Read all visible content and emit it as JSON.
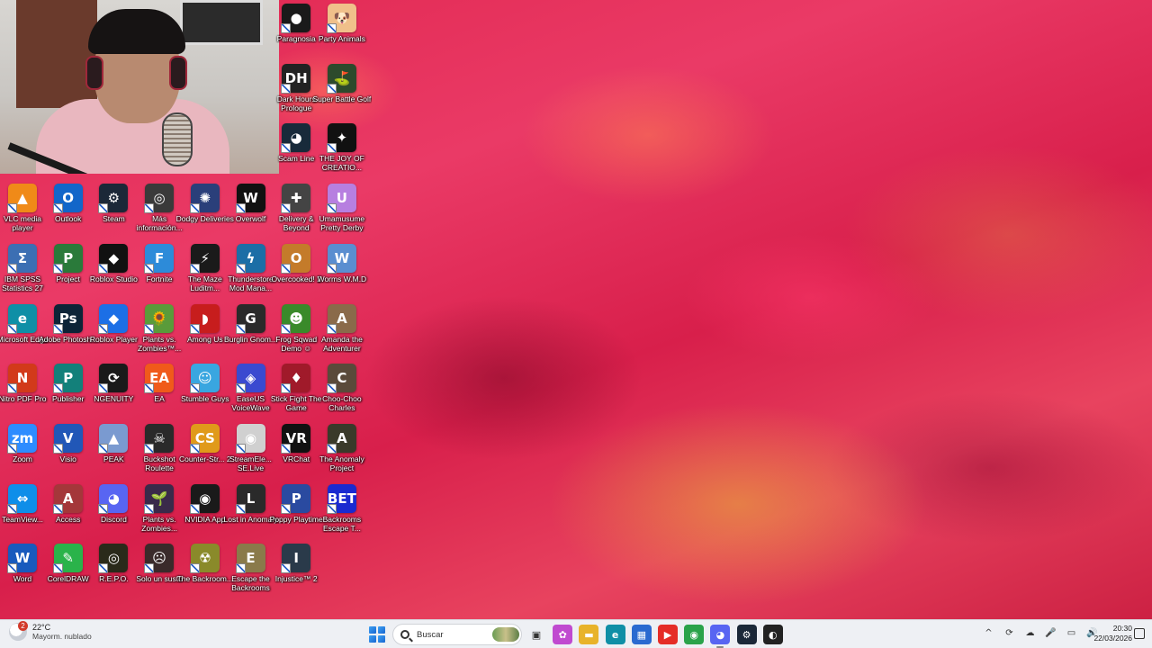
{
  "desktop": {
    "icons": [
      {
        "label": "Paragnosia",
        "glyph": "●",
        "color": "#1a1a1a"
      },
      {
        "label": "Party Animals",
        "glyph": "🐶",
        "color": "#f0c08a"
      },
      {
        "label": "Dark Hours Prologue",
        "glyph": "DH",
        "color": "#222222"
      },
      {
        "label": "Super Battle Golf",
        "glyph": "⛳",
        "color": "#2d4a2c"
      },
      {
        "label": "Scam Line",
        "glyph": "◕",
        "color": "#182a3a"
      },
      {
        "label": "THE JOY OF CREATIO...",
        "glyph": "✦",
        "color": "#111111"
      },
      {
        "label": "VLC media player",
        "glyph": "▲",
        "color": "#f08a18"
      },
      {
        "label": "Outlook",
        "glyph": "O",
        "color": "#1266c9"
      },
      {
        "label": "Steam",
        "glyph": "⚙",
        "color": "#1b2838"
      },
      {
        "label": "Más información...",
        "glyph": "◎",
        "color": "#3a3a3a"
      },
      {
        "label": "Dodgy Deliveries",
        "glyph": "✺",
        "color": "#2a3f7a"
      },
      {
        "label": "Overwolf",
        "glyph": "W",
        "color": "#111111"
      },
      {
        "label": "Delivery & Beyond",
        "glyph": "✚",
        "color": "#444444"
      },
      {
        "label": "Umamusume Pretty Derby",
        "glyph": "U",
        "color": "#b77fe0"
      },
      {
        "label": "IBM SPSS Statistics 27",
        "glyph": "Σ",
        "color": "#3c6fb3"
      },
      {
        "label": "Project",
        "glyph": "P",
        "color": "#2a7a3a"
      },
      {
        "label": "Roblox Studio",
        "glyph": "◆",
        "color": "#111111"
      },
      {
        "label": "Fortnite",
        "glyph": "F",
        "color": "#2d8bd9"
      },
      {
        "label": "The Maze Luditm...",
        "glyph": "⚡",
        "color": "#1a1a1a"
      },
      {
        "label": "Thunderstore Mod Mana...",
        "glyph": "ϟ",
        "color": "#1c6ea6"
      },
      {
        "label": "Overcooked! 2",
        "glyph": "O",
        "color": "#c47b2a"
      },
      {
        "label": "Worms W.M.D",
        "glyph": "W",
        "color": "#5a8ed0"
      },
      {
        "label": "Microsoft Edge",
        "glyph": "e",
        "color": "#0f8fa6"
      },
      {
        "label": "Adobe Photosh...",
        "glyph": "Ps",
        "color": "#0d2437"
      },
      {
        "label": "Roblox Player",
        "glyph": "◆",
        "color": "#1c6fe6"
      },
      {
        "label": "Plants vs. Zombies™...",
        "glyph": "🌻",
        "color": "#5a9b3a"
      },
      {
        "label": "Among Us",
        "glyph": "◗",
        "color": "#c71d1d"
      },
      {
        "label": "Burglin Gnom...",
        "glyph": "G",
        "color": "#2a2a2a"
      },
      {
        "label": "Frog Sqwad Demo ☺",
        "glyph": "☻",
        "color": "#3a8a2a"
      },
      {
        "label": "Amanda the Adventurer",
        "glyph": "A",
        "color": "#8a6a4a"
      },
      {
        "label": "Nitro PDF Pro",
        "glyph": "N",
        "color": "#d23a1a"
      },
      {
        "label": "Publisher",
        "glyph": "P",
        "color": "#13807a"
      },
      {
        "label": "NGENUITY",
        "glyph": "⟳",
        "color": "#1a1a1a"
      },
      {
        "label": "EA",
        "glyph": "EA",
        "color": "#f05a1a"
      },
      {
        "label": "Stumble Guys",
        "glyph": "☺",
        "color": "#39a6e0"
      },
      {
        "label": "EaseUS VoiceWave",
        "glyph": "◈",
        "color": "#3a4ad0"
      },
      {
        "label": "Stick Fight The Game",
        "glyph": "♦",
        "color": "#a01a2a"
      },
      {
        "label": "Choo-Choo Charles",
        "glyph": "C",
        "color": "#5a4a3a"
      },
      {
        "label": "Zoom",
        "glyph": "zm",
        "color": "#2d8cff"
      },
      {
        "label": "Visio",
        "glyph": "V",
        "color": "#2157b7"
      },
      {
        "label": "PEAK",
        "glyph": "▲",
        "color": "#7a9ad0"
      },
      {
        "label": "Buckshot Roulette",
        "glyph": "☠",
        "color": "#2a2a2a"
      },
      {
        "label": "Counter-Str... 2",
        "glyph": "CS",
        "color": "#e09a1a"
      },
      {
        "label": "StreamEle... SE.Live",
        "glyph": "◉",
        "color": "#d0d0d0"
      },
      {
        "label": "VRChat",
        "glyph": "VR",
        "color": "#111111"
      },
      {
        "label": "The Anomaly Project",
        "glyph": "A",
        "color": "#3a3a2a"
      },
      {
        "label": "TeamView...",
        "glyph": "⇔",
        "color": "#0e8ee9"
      },
      {
        "label": "Access",
        "glyph": "A",
        "color": "#a4373a"
      },
      {
        "label": "Discord",
        "glyph": "◕",
        "color": "#5865f2"
      },
      {
        "label": "Plants vs. Zombies...",
        "glyph": "🌱",
        "color": "#3a2a4a"
      },
      {
        "label": "NVIDIA App",
        "glyph": "◉",
        "color": "#1a1a1a"
      },
      {
        "label": "Lost in Anomaly",
        "glyph": "L",
        "color": "#2a2a2a"
      },
      {
        "label": "Poppy Playtime",
        "glyph": "P",
        "color": "#2a4aa0"
      },
      {
        "label": "Backrooms Escape T...",
        "glyph": "BET",
        "color": "#1a2ad0"
      },
      {
        "label": "Word",
        "glyph": "W",
        "color": "#185abd"
      },
      {
        "label": "CorelDRAW",
        "glyph": "✎",
        "color": "#2ab34a"
      },
      {
        "label": "R.E.P.O.",
        "glyph": "◎",
        "color": "#2a2a1a"
      },
      {
        "label": "Solo un susto",
        "glyph": "☹",
        "color": "#3a2a2a"
      },
      {
        "label": "The Backroom...",
        "glyph": "☢",
        "color": "#8a8a2a"
      },
      {
        "label": "Escape the Backrooms",
        "glyph": "E",
        "color": "#8a7a4a"
      },
      {
        "label": "Injustice™ 2",
        "glyph": "I",
        "color": "#2a3a4a"
      }
    ]
  },
  "taskbar": {
    "weather": {
      "temp": "22°C",
      "desc": "Mayorm. nublado",
      "badge": "2"
    },
    "search_placeholder": "Buscar",
    "apps": [
      {
        "name": "task-view",
        "glyph": "▣",
        "color": "#333333"
      },
      {
        "name": "copilot",
        "glyph": "✿",
        "color": "#c04ad0"
      },
      {
        "name": "file-explorer",
        "glyph": "▬",
        "color": "#e8b32a"
      },
      {
        "name": "edge",
        "glyph": "e",
        "color": "#0f8fa6"
      },
      {
        "name": "store",
        "glyph": "▦",
        "color": "#2a6ad0"
      },
      {
        "name": "youtube",
        "glyph": "▶",
        "color": "#e52d27"
      },
      {
        "name": "chrome",
        "glyph": "◉",
        "color": "#2aa34a"
      },
      {
        "name": "discord",
        "glyph": "◕",
        "color": "#5865f2"
      },
      {
        "name": "steam",
        "glyph": "⚙",
        "color": "#1b2838"
      },
      {
        "name": "obs",
        "glyph": "◐",
        "color": "#222222"
      }
    ],
    "tray": [
      "^",
      "⟳",
      "☁",
      "🎤",
      "▭",
      "🔊"
    ],
    "time": "20:30",
    "date": "22/03/2026"
  }
}
